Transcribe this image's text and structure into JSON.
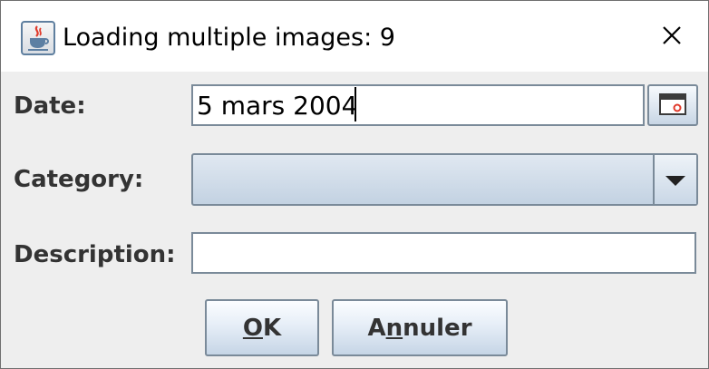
{
  "window": {
    "title": "Loading multiple images: 9",
    "icon": "java-coffee-icon"
  },
  "form": {
    "date": {
      "label": "Date:",
      "value": "5 mars 2004",
      "button_icon": "calendar-icon"
    },
    "category": {
      "label": "Category:",
      "value": "",
      "button_icon": "chevron-down-icon"
    },
    "description": {
      "label": "Description:",
      "value": ""
    }
  },
  "buttons": {
    "ok": {
      "mnemonic": "O",
      "rest": "K"
    },
    "cancel": {
      "before": "A",
      "mnemonic": "n",
      "rest": "nuler"
    }
  },
  "colors": {
    "accent_red": "#e03a2b",
    "border": "#7a8a99",
    "text": "#333333"
  }
}
